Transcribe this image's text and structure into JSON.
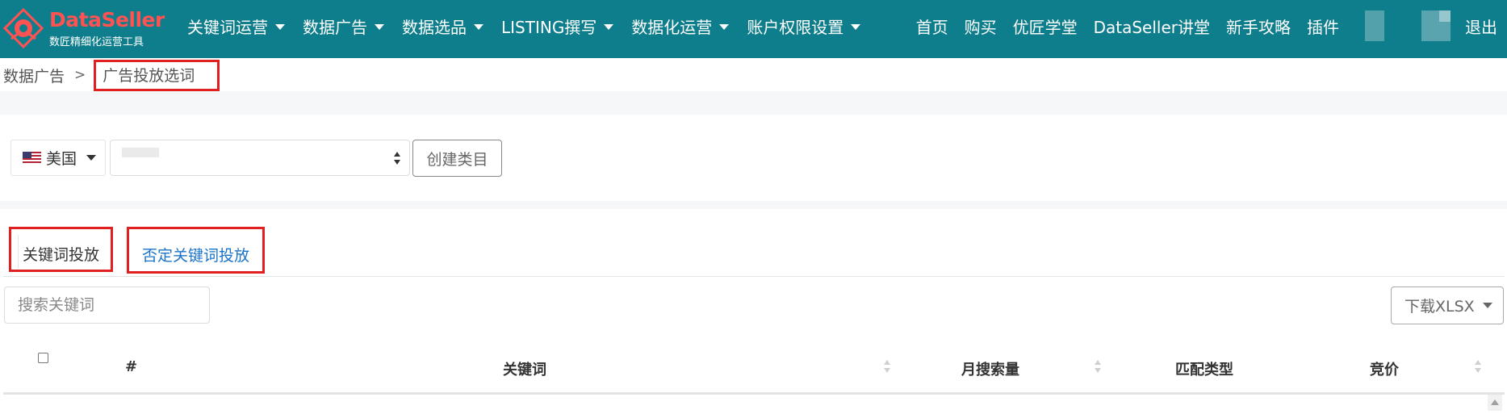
{
  "logo": {
    "title": "DataSeller",
    "subtitle": "数匠精细化运营工具"
  },
  "nav": {
    "left": [
      {
        "label": "关键词运营"
      },
      {
        "label": "数据广告"
      },
      {
        "label": "数据选品"
      },
      {
        "label": "LISTING撰写"
      },
      {
        "label": "数据化运营"
      },
      {
        "label": "账户权限设置"
      }
    ],
    "right": [
      {
        "label": "首页"
      },
      {
        "label": "购买"
      },
      {
        "label": "优匠学堂"
      },
      {
        "label": "DataSeller讲堂"
      },
      {
        "label": "新手攻略"
      },
      {
        "label": "插件"
      }
    ],
    "logout": "退出"
  },
  "breadcrumb": {
    "parent": "数据广告",
    "separator": ">",
    "current": "广告投放选词"
  },
  "filters": {
    "country": "美国",
    "create_label": "创建类目"
  },
  "tabs": [
    {
      "label": "关键词投放",
      "active": true
    },
    {
      "label": "否定关键词投放",
      "active": false
    }
  ],
  "toolbar": {
    "search_placeholder": "搜索关键词",
    "download_label": "下载XLSX"
  },
  "table": {
    "columns": [
      {
        "label": "#"
      },
      {
        "label": "关键词"
      },
      {
        "label": "月搜索量"
      },
      {
        "label": "匹配类型"
      },
      {
        "label": "竞价"
      }
    ]
  },
  "colors": {
    "nav_bg": "#0e7e8c",
    "highlight": "#e02020",
    "tab_link": "#1a73c8",
    "logo_red": "#ff5252"
  }
}
